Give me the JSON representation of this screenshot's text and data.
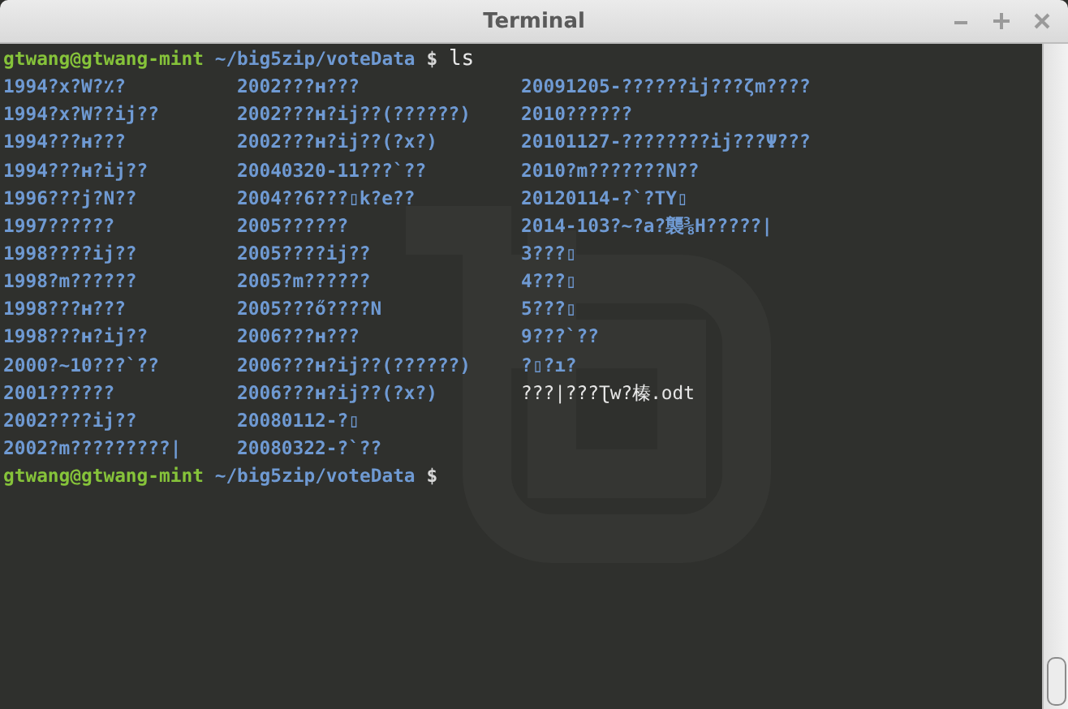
{
  "window": {
    "title": "Terminal"
  },
  "commands": [
    {
      "user_host": "gtwang@gtwang-mint",
      "path": "~/big5zip/voteData",
      "symbol": "$",
      "command": "ls"
    }
  ],
  "listing": [
    {
      "name": "1994?x?W?٪?",
      "kind": "directory"
    },
    {
      "name": "1994?x?W??ij??",
      "kind": "directory"
    },
    {
      "name": "1994???ʜ???",
      "kind": "directory"
    },
    {
      "name": "1994???ʜ?ij??",
      "kind": "directory"
    },
    {
      "name": "1996???j?N??",
      "kind": "directory"
    },
    {
      "name": "1997??????",
      "kind": "directory"
    },
    {
      "name": "1998????ij??",
      "kind": "directory"
    },
    {
      "name": "1998?m??????",
      "kind": "directory"
    },
    {
      "name": "1998???ʜ???",
      "kind": "directory"
    },
    {
      "name": "1998???ʜ?ij??",
      "kind": "directory"
    },
    {
      "name": "2000?~10???`??",
      "kind": "directory"
    },
    {
      "name": "2001??????",
      "kind": "directory"
    },
    {
      "name": "2002????ij??",
      "kind": "directory"
    },
    {
      "name": "2002?m?????????|",
      "kind": "directory"
    },
    {
      "name": "2002???ʜ???",
      "kind": "directory"
    },
    {
      "name": "2002???ʜ?ij??(??????)",
      "kind": "directory"
    },
    {
      "name": "2002???ʜ?ij??(?x?)",
      "kind": "directory"
    },
    {
      "name": "20040320-11???`??",
      "kind": "directory"
    },
    {
      "name": "2004??6???▯k?e??",
      "kind": "directory"
    },
    {
      "name": "2005??????",
      "kind": "directory"
    },
    {
      "name": "2005????ij??",
      "kind": "directory"
    },
    {
      "name": "2005?m??????",
      "kind": "directory"
    },
    {
      "name": "2005???ő????N",
      "kind": "directory"
    },
    {
      "name": "2006???ʜ???",
      "kind": "directory"
    },
    {
      "name": "2006???ʜ?ij??(??????)",
      "kind": "directory"
    },
    {
      "name": "2006???ʜ?ij??(?x?)",
      "kind": "directory"
    },
    {
      "name": "20080112-?▯",
      "kind": "directory"
    },
    {
      "name": "20080322-?`??",
      "kind": "directory"
    },
    {
      "name": "20091205-??????ij???ζm????",
      "kind": "directory"
    },
    {
      "name": "2010??????",
      "kind": "directory"
    },
    {
      "name": "20101127-????????ij???Ψ???",
      "kind": "directory"
    },
    {
      "name": "2010?m???????N??",
      "kind": "directory"
    },
    {
      "name": "20120114-?`?TY▯",
      "kind": "directory"
    },
    {
      "name": "2014-103?~?a?襲⅜H?????|",
      "kind": "directory"
    },
    {
      "name": "3???▯",
      "kind": "directory"
    },
    {
      "name": "4???▯",
      "kind": "directory"
    },
    {
      "name": "5???▯",
      "kind": "directory"
    },
    {
      "name": "9???`??",
      "kind": "directory"
    },
    {
      "name": "?▯?ı?",
      "kind": "directory"
    },
    {
      "name": "???|???Ʈw?榛.odt",
      "kind": "file"
    }
  ],
  "prompt": {
    "user_host": "gtwang@gtwang-mint",
    "path": "~/big5zip/voteData",
    "symbol": "$"
  }
}
